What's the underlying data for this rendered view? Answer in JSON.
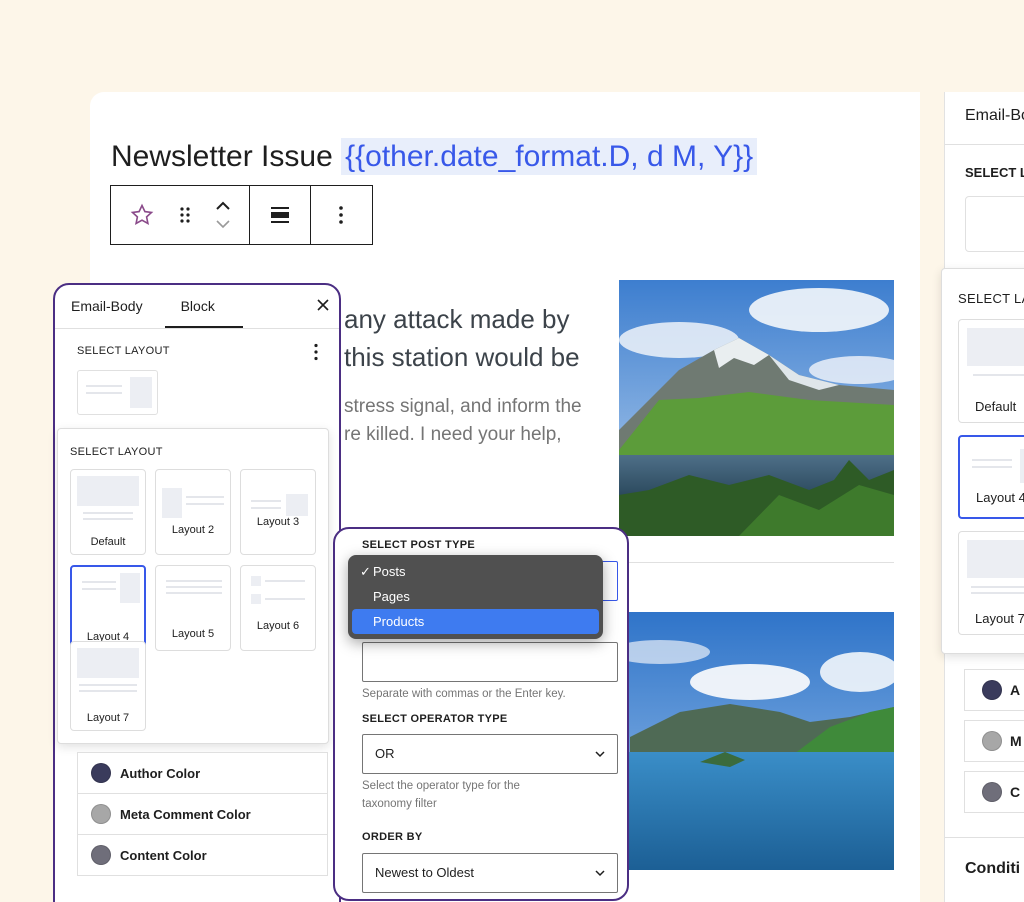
{
  "editor": {
    "title_prefix": "Newsletter Issue",
    "title_tag": "{{other.date_format.D, d M, Y}}",
    "heading_line1": "any attack made by",
    "heading_line2": "this station would be",
    "para_line1": "stress signal, and inform the",
    "para_line2": "re killed. I need your help,"
  },
  "toolbar": {
    "icons": [
      "star-icon",
      "drag-handle-icon",
      "move-up-icon",
      "move-down-icon",
      "align-icon",
      "more-options-icon"
    ]
  },
  "inspector": {
    "tabs": [
      "Email-Body",
      "Block"
    ],
    "active_tab": "Block",
    "section_label": "SELECT LAYOUT",
    "popover_label": "SELECT LAYOUT",
    "layouts": [
      "Default",
      "Layout 2",
      "Layout 3",
      "Layout 4",
      "Layout 5",
      "Layout 6",
      "Layout 7"
    ],
    "selected_layout": "Layout 4",
    "colors": [
      {
        "label": "Author Color",
        "hex": "#3a3b5c"
      },
      {
        "label": "Meta Comment Color",
        "hex": "#a7a7a7"
      },
      {
        "label": "Content Color",
        "hex": "#6f6e7a"
      }
    ]
  },
  "query_panel": {
    "post_type_label": "SELECT POST TYPE",
    "post_type_options": [
      "Posts",
      "Pages",
      "Products"
    ],
    "post_type_selected": "Posts",
    "post_type_highlighted": "Products",
    "tags_help": "Separate with commas or the Enter key.",
    "operator_label": "SELECT OPERATOR TYPE",
    "operator_value": "OR",
    "operator_help_line1": "Select the operator type for the",
    "operator_help_line2": "taxonomy filter",
    "order_label": "ORDER BY",
    "order_value": "Newest to Oldest"
  },
  "right_panel": {
    "tab": "Email-Bo",
    "section_label": "SELECT L",
    "popover_label": "SELECT LA",
    "cards": [
      "Default",
      "Layout 4",
      "Layout 7"
    ],
    "rows": [
      "A",
      "M",
      "C"
    ],
    "footer": "Conditi"
  }
}
